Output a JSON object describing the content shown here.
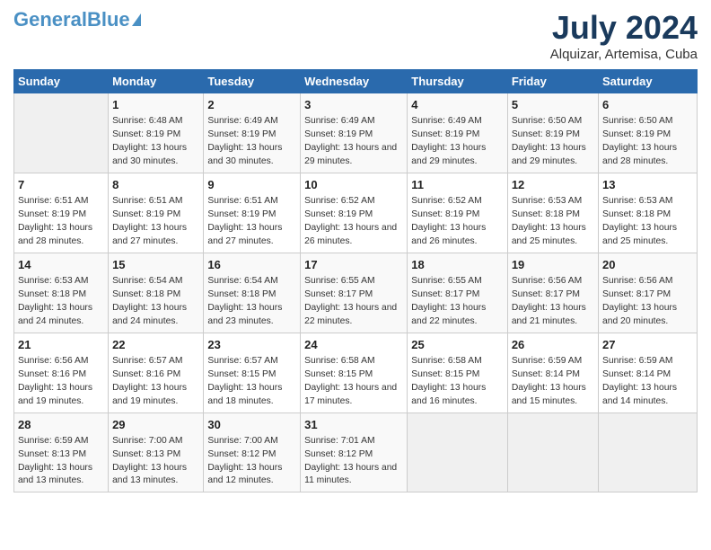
{
  "header": {
    "logo_line1": "General",
    "logo_line2": "Blue",
    "title": "July 2024",
    "subtitle": "Alquizar, Artemisa, Cuba"
  },
  "weekdays": [
    "Sunday",
    "Monday",
    "Tuesday",
    "Wednesday",
    "Thursday",
    "Friday",
    "Saturday"
  ],
  "weeks": [
    [
      {
        "day": "",
        "sunrise": "",
        "sunset": "",
        "daylight": ""
      },
      {
        "day": "1",
        "sunrise": "Sunrise: 6:48 AM",
        "sunset": "Sunset: 8:19 PM",
        "daylight": "Daylight: 13 hours and 30 minutes."
      },
      {
        "day": "2",
        "sunrise": "Sunrise: 6:49 AM",
        "sunset": "Sunset: 8:19 PM",
        "daylight": "Daylight: 13 hours and 30 minutes."
      },
      {
        "day": "3",
        "sunrise": "Sunrise: 6:49 AM",
        "sunset": "Sunset: 8:19 PM",
        "daylight": "Daylight: 13 hours and 29 minutes."
      },
      {
        "day": "4",
        "sunrise": "Sunrise: 6:49 AM",
        "sunset": "Sunset: 8:19 PM",
        "daylight": "Daylight: 13 hours and 29 minutes."
      },
      {
        "day": "5",
        "sunrise": "Sunrise: 6:50 AM",
        "sunset": "Sunset: 8:19 PM",
        "daylight": "Daylight: 13 hours and 29 minutes."
      },
      {
        "day": "6",
        "sunrise": "Sunrise: 6:50 AM",
        "sunset": "Sunset: 8:19 PM",
        "daylight": "Daylight: 13 hours and 28 minutes."
      }
    ],
    [
      {
        "day": "7",
        "sunrise": "Sunrise: 6:51 AM",
        "sunset": "Sunset: 8:19 PM",
        "daylight": "Daylight: 13 hours and 28 minutes."
      },
      {
        "day": "8",
        "sunrise": "Sunrise: 6:51 AM",
        "sunset": "Sunset: 8:19 PM",
        "daylight": "Daylight: 13 hours and 27 minutes."
      },
      {
        "day": "9",
        "sunrise": "Sunrise: 6:51 AM",
        "sunset": "Sunset: 8:19 PM",
        "daylight": "Daylight: 13 hours and 27 minutes."
      },
      {
        "day": "10",
        "sunrise": "Sunrise: 6:52 AM",
        "sunset": "Sunset: 8:19 PM",
        "daylight": "Daylight: 13 hours and 26 minutes."
      },
      {
        "day": "11",
        "sunrise": "Sunrise: 6:52 AM",
        "sunset": "Sunset: 8:19 PM",
        "daylight": "Daylight: 13 hours and 26 minutes."
      },
      {
        "day": "12",
        "sunrise": "Sunrise: 6:53 AM",
        "sunset": "Sunset: 8:18 PM",
        "daylight": "Daylight: 13 hours and 25 minutes."
      },
      {
        "day": "13",
        "sunrise": "Sunrise: 6:53 AM",
        "sunset": "Sunset: 8:18 PM",
        "daylight": "Daylight: 13 hours and 25 minutes."
      }
    ],
    [
      {
        "day": "14",
        "sunrise": "Sunrise: 6:53 AM",
        "sunset": "Sunset: 8:18 PM",
        "daylight": "Daylight: 13 hours and 24 minutes."
      },
      {
        "day": "15",
        "sunrise": "Sunrise: 6:54 AM",
        "sunset": "Sunset: 8:18 PM",
        "daylight": "Daylight: 13 hours and 24 minutes."
      },
      {
        "day": "16",
        "sunrise": "Sunrise: 6:54 AM",
        "sunset": "Sunset: 8:18 PM",
        "daylight": "Daylight: 13 hours and 23 minutes."
      },
      {
        "day": "17",
        "sunrise": "Sunrise: 6:55 AM",
        "sunset": "Sunset: 8:17 PM",
        "daylight": "Daylight: 13 hours and 22 minutes."
      },
      {
        "day": "18",
        "sunrise": "Sunrise: 6:55 AM",
        "sunset": "Sunset: 8:17 PM",
        "daylight": "Daylight: 13 hours and 22 minutes."
      },
      {
        "day": "19",
        "sunrise": "Sunrise: 6:56 AM",
        "sunset": "Sunset: 8:17 PM",
        "daylight": "Daylight: 13 hours and 21 minutes."
      },
      {
        "day": "20",
        "sunrise": "Sunrise: 6:56 AM",
        "sunset": "Sunset: 8:17 PM",
        "daylight": "Daylight: 13 hours and 20 minutes."
      }
    ],
    [
      {
        "day": "21",
        "sunrise": "Sunrise: 6:56 AM",
        "sunset": "Sunset: 8:16 PM",
        "daylight": "Daylight: 13 hours and 19 minutes."
      },
      {
        "day": "22",
        "sunrise": "Sunrise: 6:57 AM",
        "sunset": "Sunset: 8:16 PM",
        "daylight": "Daylight: 13 hours and 19 minutes."
      },
      {
        "day": "23",
        "sunrise": "Sunrise: 6:57 AM",
        "sunset": "Sunset: 8:15 PM",
        "daylight": "Daylight: 13 hours and 18 minutes."
      },
      {
        "day": "24",
        "sunrise": "Sunrise: 6:58 AM",
        "sunset": "Sunset: 8:15 PM",
        "daylight": "Daylight: 13 hours and 17 minutes."
      },
      {
        "day": "25",
        "sunrise": "Sunrise: 6:58 AM",
        "sunset": "Sunset: 8:15 PM",
        "daylight": "Daylight: 13 hours and 16 minutes."
      },
      {
        "day": "26",
        "sunrise": "Sunrise: 6:59 AM",
        "sunset": "Sunset: 8:14 PM",
        "daylight": "Daylight: 13 hours and 15 minutes."
      },
      {
        "day": "27",
        "sunrise": "Sunrise: 6:59 AM",
        "sunset": "Sunset: 8:14 PM",
        "daylight": "Daylight: 13 hours and 14 minutes."
      }
    ],
    [
      {
        "day": "28",
        "sunrise": "Sunrise: 6:59 AM",
        "sunset": "Sunset: 8:13 PM",
        "daylight": "Daylight: 13 hours and 13 minutes."
      },
      {
        "day": "29",
        "sunrise": "Sunrise: 7:00 AM",
        "sunset": "Sunset: 8:13 PM",
        "daylight": "Daylight: 13 hours and 13 minutes."
      },
      {
        "day": "30",
        "sunrise": "Sunrise: 7:00 AM",
        "sunset": "Sunset: 8:12 PM",
        "daylight": "Daylight: 13 hours and 12 minutes."
      },
      {
        "day": "31",
        "sunrise": "Sunrise: 7:01 AM",
        "sunset": "Sunset: 8:12 PM",
        "daylight": "Daylight: 13 hours and 11 minutes."
      },
      {
        "day": "",
        "sunrise": "",
        "sunset": "",
        "daylight": ""
      },
      {
        "day": "",
        "sunrise": "",
        "sunset": "",
        "daylight": ""
      },
      {
        "day": "",
        "sunrise": "",
        "sunset": "",
        "daylight": ""
      }
    ]
  ]
}
